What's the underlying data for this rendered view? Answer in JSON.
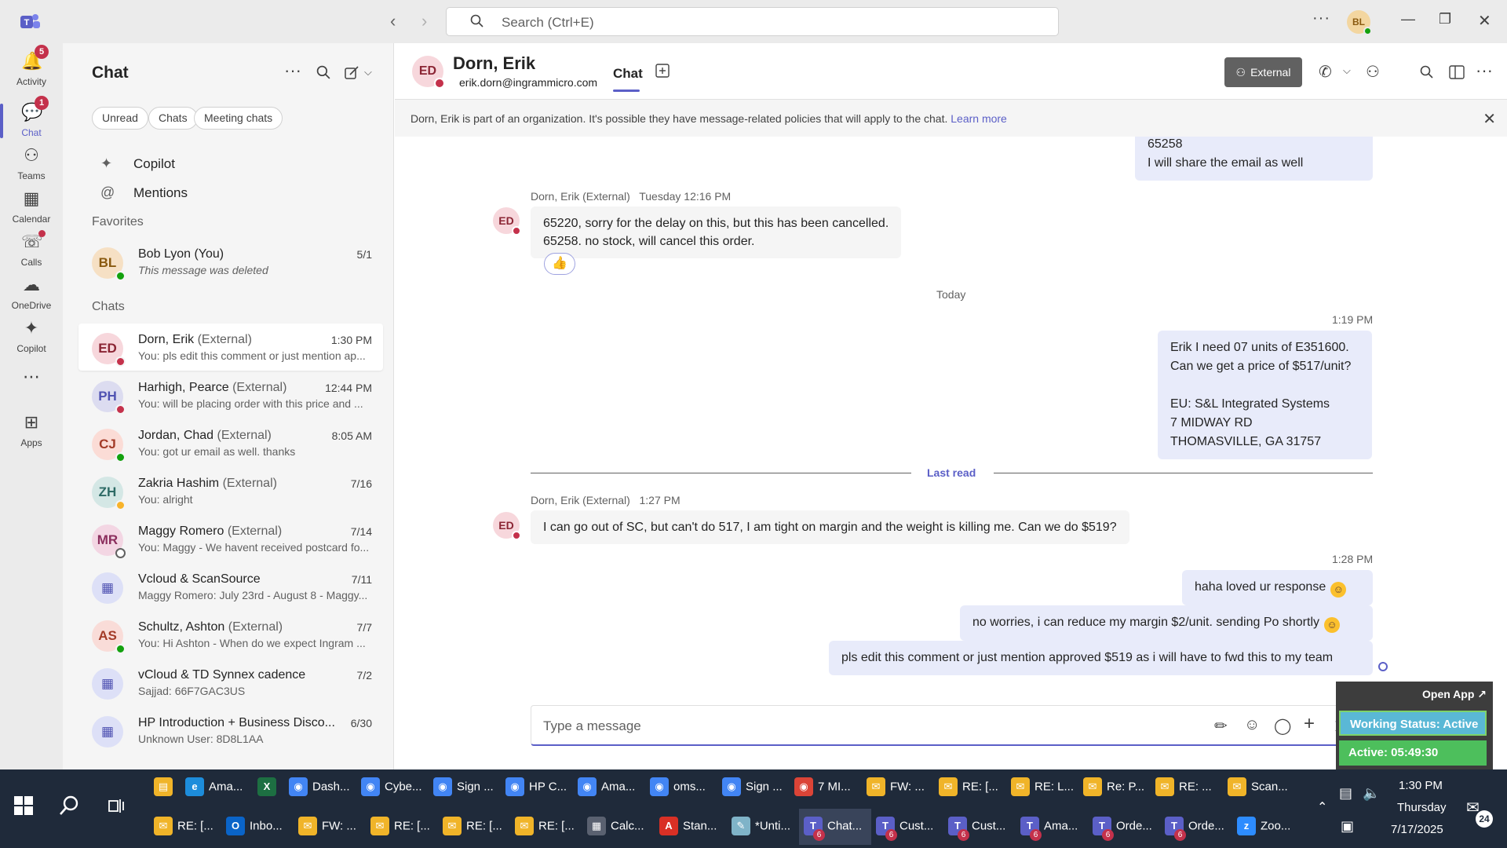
{
  "titlebar": {
    "search_placeholder": "Search (Ctrl+E)",
    "more": "···",
    "me_initials": "BL"
  },
  "rail": [
    {
      "label": "Activity",
      "badge": "5",
      "icon": "bell-icon"
    },
    {
      "label": "Chat",
      "badge": "1",
      "icon": "chat-icon",
      "active": true
    },
    {
      "label": "Teams",
      "icon": "teams-icon"
    },
    {
      "label": "Calendar",
      "icon": "calendar-icon"
    },
    {
      "label": "Calls",
      "icon": "phone-icon",
      "dot": true
    },
    {
      "label": "OneDrive",
      "icon": "cloud-icon"
    },
    {
      "label": "Copilot",
      "icon": "copilot-icon"
    },
    {
      "label": "...",
      "icon": "more-icon"
    },
    {
      "label": "Apps",
      "icon": "apps-icon"
    }
  ],
  "chatlist": {
    "title": "Chat",
    "filters": [
      "Unread",
      "Chats",
      "Meeting chats"
    ],
    "pinned": [
      {
        "label": "Copilot",
        "icon": "copilot-icon"
      },
      {
        "label": "Mentions",
        "icon": "at-icon"
      }
    ],
    "favorites_label": "Favorites",
    "favorites": [
      {
        "initials": "BL",
        "name": "Bob Lyon (You)",
        "ext": "",
        "time": "5/1",
        "preview": "This message was deleted",
        "status": "available"
      }
    ],
    "chats_label": "Chats",
    "chats": [
      {
        "initials": "ED",
        "name": "Dorn, Erik",
        "ext": "(External)",
        "time": "1:30 PM",
        "preview": "You: pls edit this comment or just mention ap...",
        "status": "busy",
        "selected": true
      },
      {
        "initials": "PH",
        "name": "Harhigh, Pearce",
        "ext": "(External)",
        "time": "12:44 PM",
        "preview": "You: will be placing order with this price and ...",
        "status": "busy"
      },
      {
        "initials": "CJ",
        "name": "Jordan, Chad",
        "ext": "(External)",
        "time": "8:05 AM",
        "preview": "You: got ur email as well. thanks",
        "status": "available"
      },
      {
        "initials": "ZH",
        "name": "Zakria Hashim",
        "ext": "(External)",
        "time": "7/16",
        "preview": "You: alright",
        "status": "away"
      },
      {
        "initials": "MR",
        "name": "Maggy Romero",
        "ext": "(External)",
        "time": "7/14",
        "preview": "You: Maggy - We havent received postcard fo...",
        "status": "offline"
      },
      {
        "initials": "",
        "name": "Vcloud & ScanSource",
        "ext": "",
        "time": "7/11",
        "preview": "Maggy Romero: July 23rd - August 8 - Maggy...",
        "status": "meeting"
      },
      {
        "initials": "AS",
        "name": "Schultz, Ashton",
        "ext": "(External)",
        "time": "7/7",
        "preview": "You: Hi Ashton -  When do we expect Ingram ...",
        "status": "available"
      },
      {
        "initials": "",
        "name": "vCloud & TD Synnex cadence",
        "ext": "",
        "time": "7/2",
        "preview": "Sajjad: 66F7GAC3US",
        "status": "meeting"
      },
      {
        "initials": "",
        "name": "HP Introduction + Business Disco...",
        "ext": "",
        "time": "6/30",
        "preview": "Unknown User: 8D8L1AA",
        "status": "meeting"
      }
    ]
  },
  "header": {
    "initials": "ED",
    "name": "Dorn, Erik",
    "email": "erik.dorn@ingrammicro.com",
    "tab": "Chat",
    "external_label": "External"
  },
  "banner": {
    "text": "Dorn, Erik is part of an organization. It's possible they have message-related policies that will apply to the chat.",
    "link": "Learn more"
  },
  "messages": {
    "top_out_lines": [
      "65258",
      "I will share the email as well"
    ],
    "m1_meta": "Dorn, Erik (External)   Tuesday 12:16 PM",
    "m1_lines": [
      "65220, sorry for the delay on this, but this has been cancelled.",
      "65258. no stock, will cancel this order."
    ],
    "m1_reaction": "👍",
    "today": "Today",
    "m2_time": "1:19 PM",
    "m2_lines": [
      "Erik I need 07 units of E351600.",
      "Can we get a price of $517/unit?",
      "",
      "EU: S&L Integrated Systems",
      "7 MIDWAY RD",
      "THOMASVILLE, GA 31757"
    ],
    "last_read": "Last read",
    "m3_meta": "Dorn, Erik (External)   1:27 PM",
    "m3_text": "I can go out of SC, but can't do 517, I am tight on margin and the weight is killing me.  Can we do $519?",
    "m4_time": "1:28 PM",
    "m4_text": "haha loved ur response",
    "m5_text": "no worries, i can reduce my margin $2/unit. sending Po shortly",
    "m6_text": "pls edit this comment or just mention approved $519 as i will have to fwd this to my team"
  },
  "composer": {
    "placeholder": "Type a message"
  },
  "workstatus": {
    "open_app": "Open App ↗",
    "status": "Working Status: Active",
    "timer": "Active: 05:49:30"
  },
  "taskbar": {
    "row1": [
      {
        "label": "",
        "icon": "folder-icon",
        "color": "#f0b429"
      },
      {
        "label": "Ama...",
        "icon": "edge-icon",
        "color": "#1d8ddb"
      },
      {
        "label": "",
        "icon": "excel-icon",
        "color": "#1d6f42"
      },
      {
        "label": "Dash...",
        "icon": "chrome-icon",
        "color": "#4285f4"
      },
      {
        "label": "Cybe...",
        "icon": "chrome-icon",
        "color": "#4285f4"
      },
      {
        "label": "Sign ...",
        "icon": "chrome-icon",
        "color": "#4285f4"
      },
      {
        "label": "HP C...",
        "icon": "chrome-icon",
        "color": "#4285f4"
      },
      {
        "label": "Ama...",
        "icon": "chrome-icon",
        "color": "#4285f4"
      },
      {
        "label": "oms...",
        "icon": "chrome-icon",
        "color": "#4285f4"
      },
      {
        "label": "Sign ...",
        "icon": "chrome-icon",
        "color": "#4285f4"
      },
      {
        "label": "7 MI...",
        "icon": "chrome-icon",
        "color": "#db4437"
      },
      {
        "label": "FW: ...",
        "icon": "mail-icon",
        "color": "#f0b429"
      },
      {
        "label": "RE: [...",
        "icon": "mail-icon",
        "color": "#f0b429"
      },
      {
        "label": "RE: L...",
        "icon": "mail-icon",
        "color": "#f0b429"
      },
      {
        "label": "Re: P...",
        "icon": "mail-icon",
        "color": "#f0b429"
      },
      {
        "label": "RE: ...",
        "icon": "mail-icon",
        "color": "#f0b429"
      },
      {
        "label": "Scan...",
        "icon": "mail-icon",
        "color": "#f0b429"
      }
    ],
    "row2": [
      {
        "label": "RE: [...",
        "icon": "mail-icon",
        "color": "#f0b429"
      },
      {
        "label": "Inbo...",
        "icon": "outlook-icon",
        "color": "#0a64c8"
      },
      {
        "label": "FW: ...",
        "icon": "mail-icon",
        "color": "#f0b429"
      },
      {
        "label": "RE: [...",
        "icon": "mail-icon",
        "color": "#f0b429"
      },
      {
        "label": "RE: [...",
        "icon": "mail-icon",
        "color": "#f0b429"
      },
      {
        "label": "RE: [...",
        "icon": "mail-icon",
        "color": "#f0b429"
      },
      {
        "label": "Calc...",
        "icon": "calculator-icon",
        "color": "#5a6170"
      },
      {
        "label": "Stan...",
        "icon": "pdf-icon",
        "color": "#d93025"
      },
      {
        "label": "*Unti...",
        "icon": "notepad-icon",
        "color": "#7fb3c8"
      },
      {
        "label": "Chat...",
        "icon": "teams-icon",
        "color": "#5b5fc7",
        "count": "6",
        "selected": true
      },
      {
        "label": "Cust...",
        "icon": "teams-icon",
        "color": "#5b5fc7",
        "count": "6"
      },
      {
        "label": "Cust...",
        "icon": "teams-icon",
        "color": "#5b5fc7",
        "count": "6"
      },
      {
        "label": "Ama...",
        "icon": "teams-icon",
        "color": "#5b5fc7",
        "count": "6"
      },
      {
        "label": "Orde...",
        "icon": "teams-icon",
        "color": "#5b5fc7",
        "count": "6"
      },
      {
        "label": "Orde...",
        "icon": "teams-icon",
        "color": "#5b5fc7",
        "count": "6"
      },
      {
        "label": "Zoo...",
        "icon": "zoom-icon",
        "color": "#2d8cff"
      }
    ],
    "time": "1:30 PM",
    "day": "Thursday",
    "date": "7/17/2025",
    "notifications": "24"
  }
}
